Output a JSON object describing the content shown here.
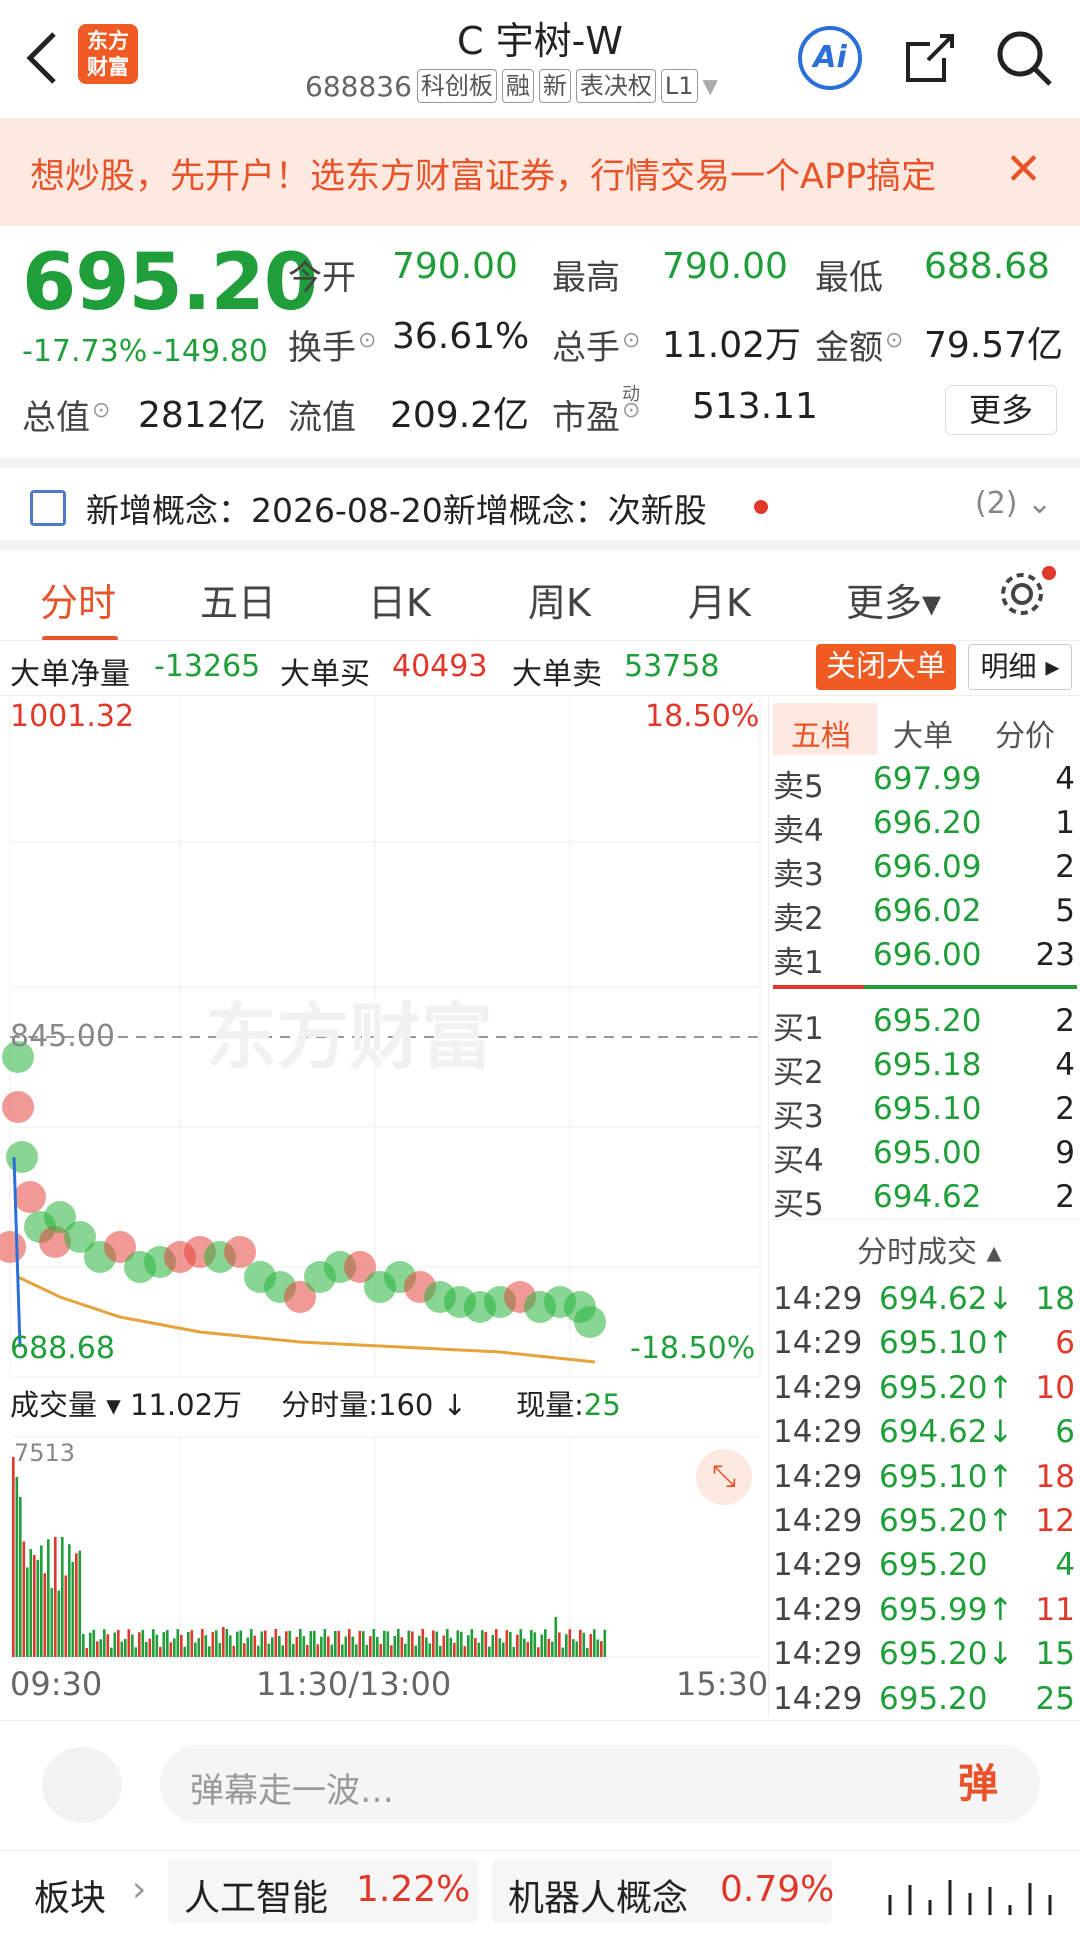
{
  "header": {
    "logo": "东方财富",
    "title": "C 宇树-W",
    "code": "688836",
    "tags": [
      "科创板",
      "融",
      "新",
      "表决权",
      "L1"
    ],
    "ai_label": "Ai"
  },
  "banner": {
    "text": "想炒股，先开户！选东方财富证券，行情交易一个APP搞定",
    "close": "✕"
  },
  "quote": {
    "price": "695.20",
    "change_pct": "-17.73%",
    "change": "-149.80",
    "fields": [
      {
        "label": "今开",
        "value": "790.00",
        "color": "green"
      },
      {
        "label": "最高",
        "value": "790.00",
        "color": "green"
      },
      {
        "label": "最低",
        "value": "688.68",
        "color": "green"
      },
      {
        "label": "换手",
        "value": "36.61%",
        "color": "dark"
      },
      {
        "label": "总手",
        "value": "11.02万",
        "color": "dark"
      },
      {
        "label": "金额",
        "value": "79.57亿",
        "color": "dark"
      },
      {
        "label": "总值",
        "value": "2812亿",
        "color": "dark"
      },
      {
        "label": "流值",
        "value": "209.2亿",
        "color": "dark"
      },
      {
        "label": "市盈",
        "value": "513.11",
        "color": "dark",
        "sup": "动"
      }
    ],
    "more": "更多"
  },
  "concept": {
    "text": "新增概念：2026-08-20新增概念：次新股",
    "count": "(2)"
  },
  "tabs": [
    "分时",
    "五日",
    "日K",
    "周K",
    "月K",
    "更多▾"
  ],
  "bigorder": {
    "net_label": "大单净量",
    "net": "-13265",
    "buy_label": "大单买",
    "buy": "40493",
    "sell_label": "大单卖",
    "sell": "53758",
    "close": "关闭大单",
    "detail": "明细 ▸"
  },
  "chart": {
    "price_high": "1001.32",
    "price_mid": "845.00",
    "price_low": "688.68",
    "pct_high": "18.50%",
    "pct_low": "-18.50%",
    "watermark": "东方财富",
    "vol_label": "成交量 ▾",
    "vol_value": "11.02万",
    "tick_label": "分时量:160 ↓",
    "now_label": "现量:",
    "now_value": "25",
    "vol_max": "7513",
    "times": [
      "09:30",
      "11:30/13:00",
      "15:30"
    ]
  },
  "book": {
    "tabs": [
      "五档",
      "大单",
      "分价"
    ],
    "sells": [
      {
        "label": "卖5",
        "price": "697.99",
        "vol": "4"
      },
      {
        "label": "卖4",
        "price": "696.20",
        "vol": "1"
      },
      {
        "label": "卖3",
        "price": "696.09",
        "vol": "2"
      },
      {
        "label": "卖2",
        "price": "696.02",
        "vol": "5"
      },
      {
        "label": "卖1",
        "price": "696.00",
        "vol": "23"
      }
    ],
    "buys": [
      {
        "label": "买1",
        "price": "695.20",
        "vol": "2"
      },
      {
        "label": "买2",
        "price": "695.18",
        "vol": "4"
      },
      {
        "label": "买3",
        "price": "695.10",
        "vol": "2"
      },
      {
        "label": "买4",
        "price": "695.00",
        "vol": "9"
      },
      {
        "label": "买5",
        "price": "694.62",
        "vol": "2"
      }
    ],
    "ticks_title": "分时成交 ▴",
    "ticks": [
      {
        "t": "14:29",
        "p": "694.62↓",
        "v": "18",
        "dir": "down"
      },
      {
        "t": "14:29",
        "p": "695.10↑",
        "v": "6",
        "dir": "up"
      },
      {
        "t": "14:29",
        "p": "695.20↑",
        "v": "10",
        "dir": "up"
      },
      {
        "t": "14:29",
        "p": "694.62↓",
        "v": "6",
        "dir": "down"
      },
      {
        "t": "14:29",
        "p": "695.10↑",
        "v": "18",
        "dir": "up"
      },
      {
        "t": "14:29",
        "p": "695.20↑",
        "v": "12",
        "dir": "up"
      },
      {
        "t": "14:29",
        "p": "695.20",
        "v": "4",
        "dir": "none"
      },
      {
        "t": "14:29",
        "p": "695.99↑",
        "v": "11",
        "dir": "up"
      },
      {
        "t": "14:29",
        "p": "695.20↓",
        "v": "15",
        "dir": "down"
      },
      {
        "t": "14:29",
        "p": "695.20",
        "v": "25",
        "dir": "none"
      }
    ]
  },
  "danmu": {
    "placeholder": "弹幕走一波…",
    "btn": "弹"
  },
  "sector": {
    "label": "板块",
    "items": [
      {
        "name": "人工智能",
        "pct": "1.22%"
      },
      {
        "name": "机器人概念",
        "pct": "0.79%"
      }
    ]
  }
}
